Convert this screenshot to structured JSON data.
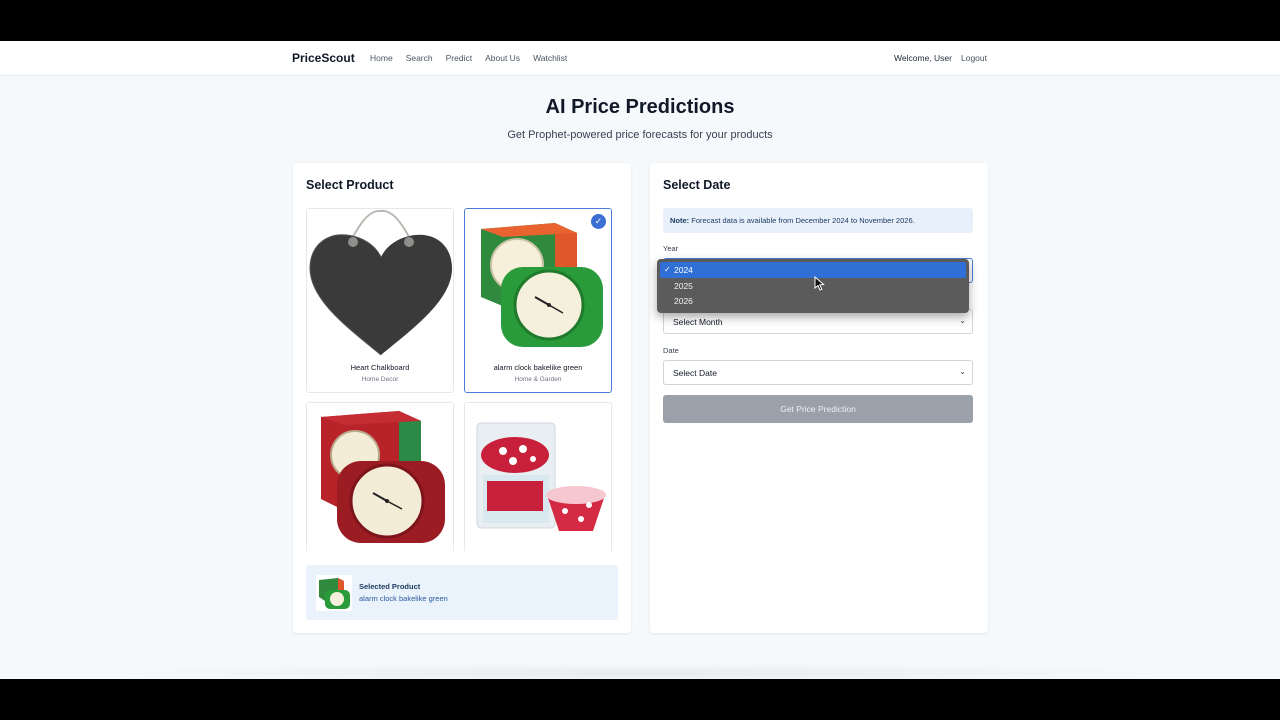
{
  "nav": {
    "brand": "PriceScout",
    "links": [
      "Home",
      "Search",
      "Predict",
      "About Us",
      "Watchlist"
    ],
    "welcome": "Welcome, User",
    "logout": "Logout"
  },
  "header": {
    "title": "AI Price Predictions",
    "subtitle": "Get Prophet-powered price forecasts for your products"
  },
  "product_panel": {
    "title": "Select Product",
    "products": [
      {
        "name": "Heart Chalkboard",
        "category": "Home Decor",
        "selected": false
      },
      {
        "name": "alarm clock bakelike green",
        "category": "Home & Garden",
        "selected": true
      },
      {
        "name": "",
        "category": "",
        "selected": false
      },
      {
        "name": "",
        "category": "",
        "selected": false
      }
    ],
    "selected_label": "Selected Product",
    "selected_name": "alarm clock bakelike green"
  },
  "date_panel": {
    "title": "Select Date",
    "note_prefix": "Note:",
    "note_text": " Forecast data is available from December 2024 to November 2026.",
    "year_label": "Year",
    "year_options": [
      "2024",
      "2025",
      "2026"
    ],
    "year_selected": "2024",
    "month_placeholder": "Select Month",
    "date_label": "Date",
    "date_placeholder": "Select Date",
    "submit_label": "Get Price Prediction"
  },
  "icons": {
    "check": "check-icon",
    "chevron": "chevron-down-icon",
    "cursor": "mouse-pointer-icon"
  },
  "colors": {
    "accent": "#3b6fd4",
    "button_disabled": "#9aa1aa",
    "note_bg": "#e8f1fb",
    "dropdown_bg": "#5b5b5b",
    "dropdown_active": "#2f6fd6"
  }
}
